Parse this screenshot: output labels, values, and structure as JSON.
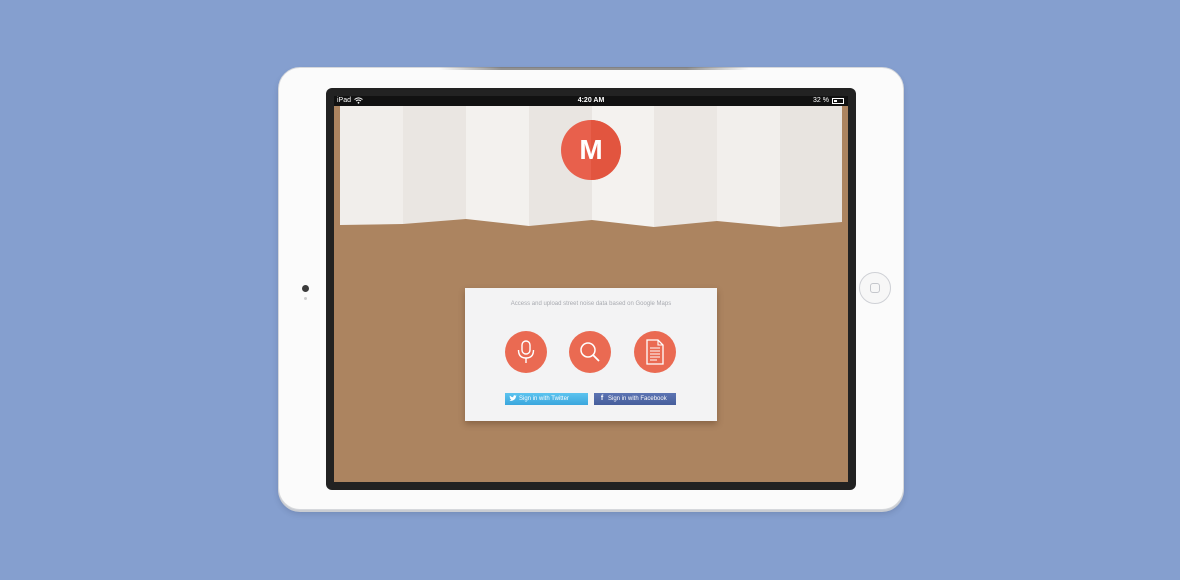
{
  "status_bar": {
    "carrier": "iPad",
    "time": "4:20 AM",
    "battery": "32 %"
  },
  "logo": {
    "letter": "M"
  },
  "card": {
    "tagline": "Access and upload street noise data based on Google Maps",
    "twitter_label": "Sign in with Twitter",
    "facebook_label": "Sign in with Facebook"
  },
  "colors": {
    "background": "#859fcf",
    "accent": "#ea6a52",
    "board": "#ac8460",
    "twitter": "#4ab5e8",
    "facebook": "#4f67a6"
  },
  "icons": {
    "record": "microphone-icon",
    "search": "search-icon",
    "list": "document-icon"
  }
}
